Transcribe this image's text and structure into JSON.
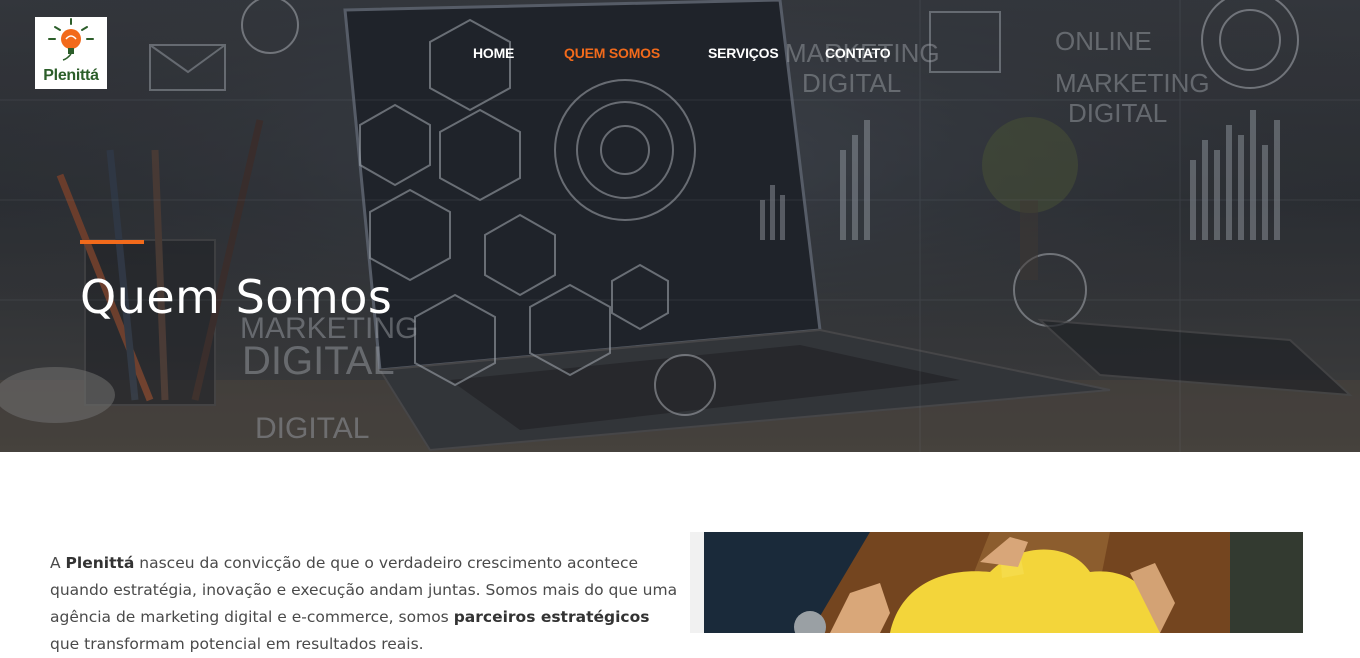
{
  "brand": {
    "name": "Plenittá",
    "accent_color": "#f26a1b"
  },
  "nav": {
    "items": [
      {
        "label": "HOME",
        "active": false
      },
      {
        "label": "QUEM SOMOS",
        "active": true
      },
      {
        "label": "SERVIÇOS",
        "active": false
      },
      {
        "label": "CONTATO",
        "active": false
      }
    ]
  },
  "hero": {
    "title": "Quem Somos",
    "background_words": [
      "MARKETING",
      "DIGITAL",
      "ONLINE",
      "MARKETING",
      "DIGITAL",
      "MARKETING",
      "DIGITAL",
      "DIGITAL"
    ]
  },
  "intro": {
    "p1": "A ",
    "brand": "Plenittá",
    "p2": " nasceu da convicção de que o verdadeiro crescimento acontece quando estratégia, inovação e execução andam juntas. Somos mais do que uma agência de marketing digital e e-commerce, somos ",
    "strong": "parceiros estratégicos",
    "p3": " que transformam potencial em resultados reais."
  }
}
